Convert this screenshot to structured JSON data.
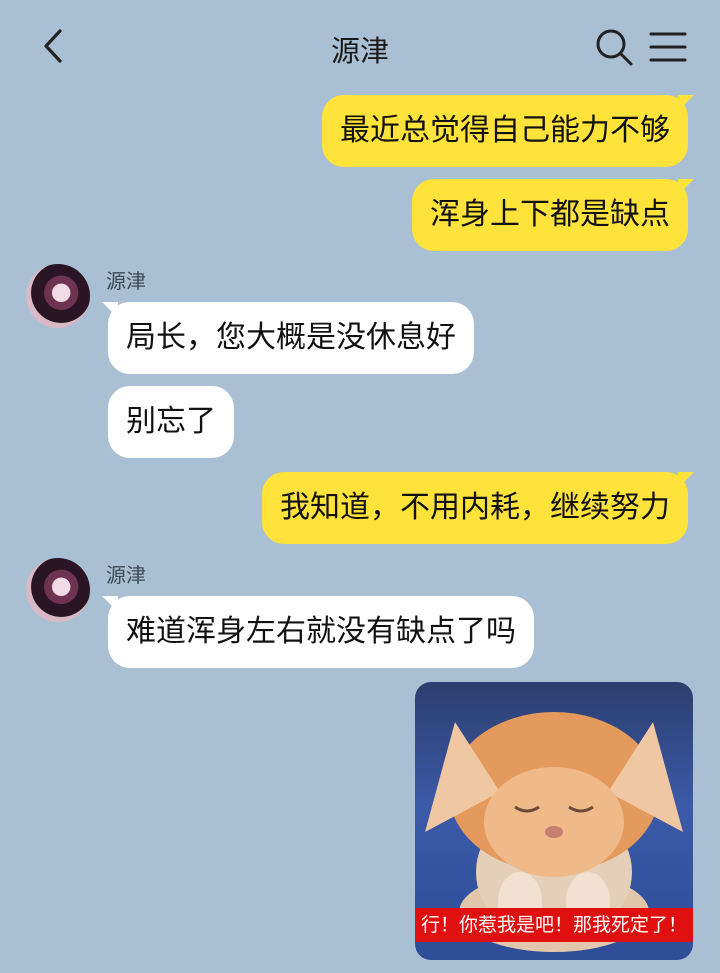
{
  "header": {
    "title": "源津"
  },
  "icons": {
    "back": "chevron-left-icon",
    "search": "search-icon",
    "menu": "hamburger-menu-icon"
  },
  "colors": {
    "background": "#a9bfd3",
    "my_bubble": "#ffe33b",
    "their_bubble": "#ffffff",
    "caption_bg": "#e01010"
  },
  "messages": [
    {
      "from": "me",
      "text": "最近总觉得自己能力不够"
    },
    {
      "from": "me",
      "text": "浑身上下都是缺点"
    },
    {
      "from": "other",
      "sender": "源津",
      "text": "局长，您大概是没休息好"
    },
    {
      "from": "other",
      "text": "别忘了"
    },
    {
      "from": "me",
      "text": "我知道，不用内耗，继续努力"
    },
    {
      "from": "other",
      "sender": "源津",
      "text": "难道浑身左右就没有缺点了吗"
    }
  ],
  "sticker": {
    "caption": "行！你惹我是吧！那我死定了！"
  }
}
